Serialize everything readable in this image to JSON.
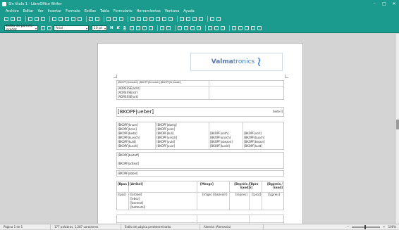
{
  "window": {
    "title": "Sin título 1 - LibreOffice Writer",
    "controls": [
      "–",
      "□",
      "✕"
    ]
  },
  "menu": [
    "Archivo",
    "Editar",
    "Ver",
    "Insertar",
    "Formato",
    "Estilos",
    "Tabla",
    "Formulario",
    "Herramientas",
    "Ventana",
    "Ayuda"
  ],
  "toolbar": {
    "paragraph_style": "Estilo de párrafo predet",
    "font_name": "Arial",
    "font_size": "10 pt",
    "bold": "N",
    "italic": "K",
    "underline": "S"
  },
  "document": {
    "logo": {
      "part1": "Valma",
      "part2": "tronics"
    },
    "address_header": "[BKOPF|firmaadr] [BKOPF|firmaadr] [BKOPF|firmaadr]",
    "address_lines": [
      "[ADRESSE|adrs]",
      "[ADRESSE|str]",
      "[ADRESSE|ort]"
    ],
    "title_field": "[BKOPF|ueber]",
    "page_label": "Seite [[",
    "info_col1": [
      "[BKOPF|knum]",
      "[BKOPF|kcon]",
      "[BKOPF|bedb]",
      "[BKOPF|kuvsch]",
      "[BKOPF|kuld]",
      "[BKOPF|kusch]"
    ],
    "info_col2": [
      "[BKOPF|ebelg]",
      "[BKOPF|vom]",
      "[BKOPF|kuli]",
      "[BKOPF|unsch]",
      "[BKOPF|uuld]",
      "[BKOPF|uusr]"
    ],
    "info_col3": [
      "[BKOPF|vorh]",
      "[BKOPF|unsch]",
      "[BKOPF|vbezon]",
      "[BKOPF|kusld]"
    ],
    "info_col4": [
      "[BKOPF|vorl]",
      "[BKOPF|busch]",
      "[BKOPF|bezon]",
      "[BKOPF|kuld]"
    ],
    "text_fields": [
      "[BKOPF|beitoff]",
      "[BKOPF|adtext]",
      "[BKOPF|abbel]"
    ],
    "table_headers": [
      "[Bpos ]",
      "[Artikel]",
      "[Menge]",
      "[Bepreis / Eand]",
      "[Bpro z]",
      "[Bgpreis / Eand]"
    ],
    "table_row": {
      "pos": "[[pos]",
      "artikel": [
        "[[artikel]",
        "[[ebez]",
        "[[bertext]",
        "[[bettextsi]"
      ],
      "menge": "[[mge]",
      "einheit": "[[bezeinh]",
      "epreis": "[[epreis]",
      "proz": "[[proz]",
      "gpreis": "[[gpreis]"
    }
  },
  "status": {
    "page": "Página 1 de 1",
    "words": "177 palabras, 1,287 caracteres",
    "page_style": "Estilo de página predeterminado",
    "language": "Alemán (Alemania)",
    "zoom": "100%"
  }
}
